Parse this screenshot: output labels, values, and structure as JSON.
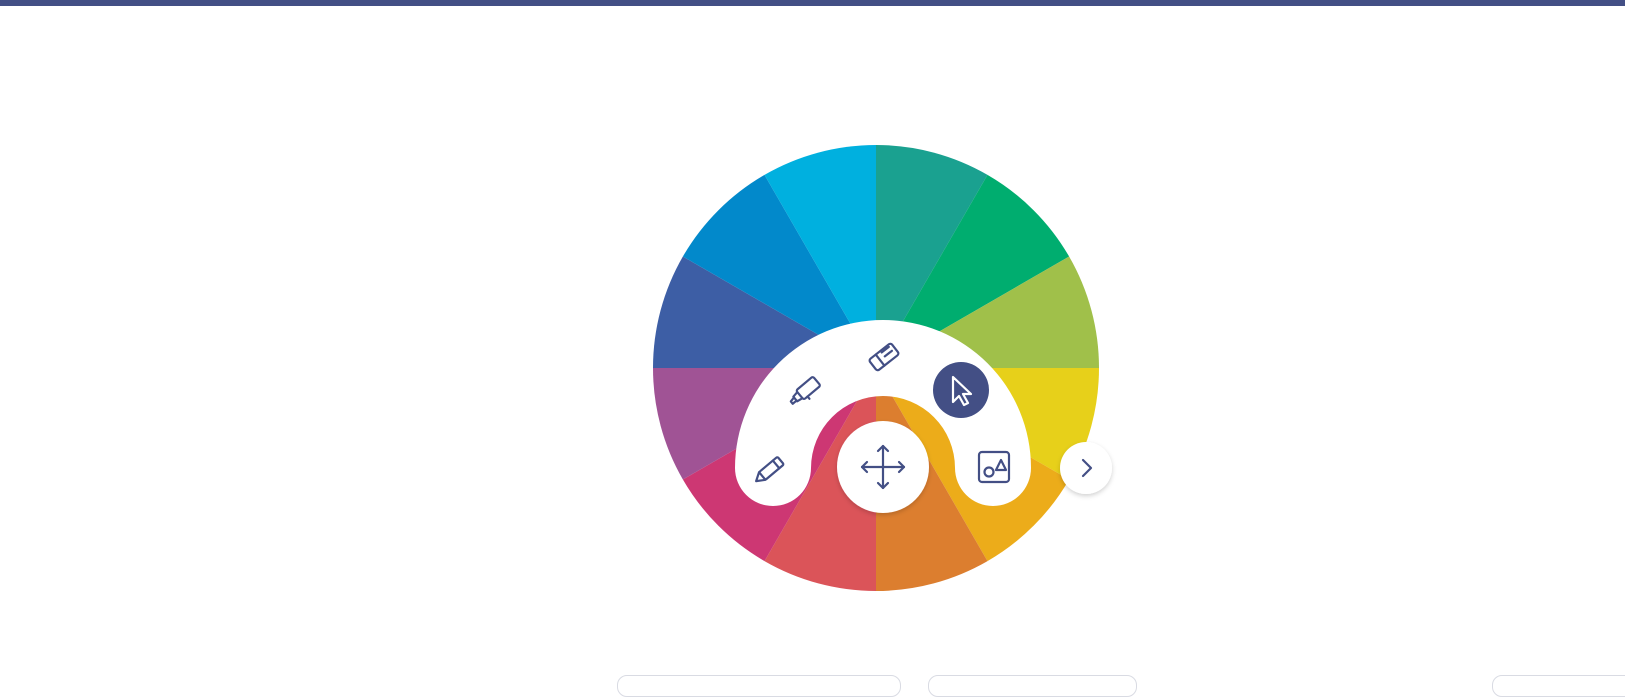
{
  "theme": {
    "top_bar_color": "#434f85",
    "icon_color": "#434f85",
    "active_tool_bg": "#434f85",
    "active_tool_fg": "#ffffff",
    "panel_bg": "#ffffff"
  },
  "color_wheel": {
    "segments": [
      {
        "name": "teal",
        "color": "#1aa190"
      },
      {
        "name": "green",
        "color": "#00ad6f"
      },
      {
        "name": "lime",
        "color": "#a0c04a"
      },
      {
        "name": "yellow",
        "color": "#e7d01a"
      },
      {
        "name": "amber",
        "color": "#ecac1a"
      },
      {
        "name": "orange",
        "color": "#dc7e2f"
      },
      {
        "name": "red",
        "color": "#db5459"
      },
      {
        "name": "pink",
        "color": "#cd3773"
      },
      {
        "name": "purple",
        "color": "#a05395"
      },
      {
        "name": "indigo",
        "color": "#3d5ea5"
      },
      {
        "name": "blue",
        "color": "#0289cb"
      },
      {
        "name": "cyan",
        "color": "#00b0df"
      }
    ]
  },
  "tools": [
    {
      "id": "pen",
      "icon": "pencil-icon",
      "active": false
    },
    {
      "id": "highlighter",
      "icon": "highlighter-icon",
      "active": false
    },
    {
      "id": "eraser",
      "icon": "eraser-icon",
      "active": false
    },
    {
      "id": "select",
      "icon": "cursor-icon",
      "active": true
    },
    {
      "id": "shapes",
      "icon": "shapes-icon",
      "active": false
    }
  ],
  "move_handle": {
    "icon": "move-arrows-icon"
  },
  "next_button": {
    "icon": "chevron-right-icon"
  }
}
